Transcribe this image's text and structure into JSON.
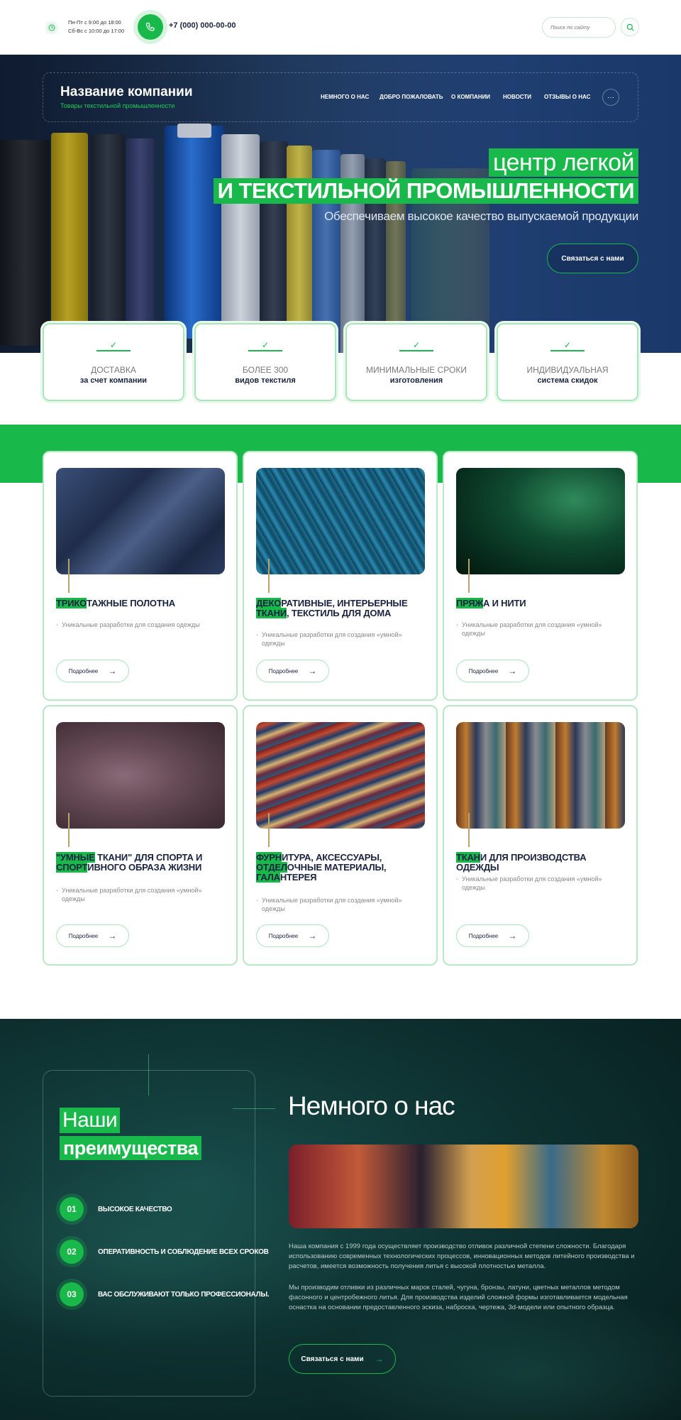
{
  "topbar": {
    "hours_line1": "Пн-Пт с 9:00 до 18:00",
    "hours_line2": "Сб-Вс с 10:00 до 17:00",
    "phone": "+7 (000) 000-00-00",
    "search_placeholder": "Поиск по сайту"
  },
  "header": {
    "company_name": "Название компании",
    "company_sub": "Товары текстильной промышленности",
    "nav": [
      "Немного о нас",
      "Добро пожаловать",
      "О компании",
      "Новости",
      "Отзывы о нас"
    ],
    "more": "···"
  },
  "hero": {
    "title_line1": "центр легкой",
    "title_line2": "И ТЕКСТИЛЬНОЙ ПРОМЫШЛЕННОСТИ",
    "subtitle": "Обеспечиваем высокое качество выпускаемой продукции",
    "cta": "Связаться с нами"
  },
  "features": [
    {
      "top": "Доставка",
      "bottom": "за счет компании"
    },
    {
      "top": "Более 300",
      "bottom": "видов текстиля"
    },
    {
      "top": "Минимальные сроки",
      "bottom": "изготовления"
    },
    {
      "top": "Индивидуальная",
      "bottom": "система скидок"
    }
  ],
  "products": [
    {
      "title_hl": "Трико",
      "title_rest": "тажные полотна",
      "title_hl2": "",
      "title_rest2": "",
      "desc": "Уникальные разработки для создания одежды",
      "button": "Подробнее"
    },
    {
      "title_hl": "Деко",
      "title_rest": "ративные, интерьерные",
      "title_hl2": "ткани",
      "title_rest2": ", текстиль для дома",
      "desc": "Уникальные разработки для создания «умной» одежды",
      "button": "Подробнее"
    },
    {
      "title_hl": "Пряж",
      "title_rest": "а и нити",
      "title_hl2": "",
      "title_rest2": "",
      "desc": "Уникальные разработки для создания «умной» одежды",
      "button": "Подробнее"
    },
    {
      "title_hl": "\"Умные",
      "title_rest": " ткани\" для спорта и",
      "title_hl2": "спорт",
      "title_rest2": "ивного образа жизни",
      "desc": "Уникальные разработки для создания «умной» одежды",
      "button": "Подробнее"
    },
    {
      "title_hl": "Фурн",
      "title_rest": "итура, аксессуары,",
      "title_hl2": "отдел",
      "title_rest2": "очные материалы,",
      "title_hl3": "гала",
      "title_rest3": "нтерея",
      "desc": "Уникальные разработки для создания «умной» одежды",
      "button": "Подробнее"
    },
    {
      "title_hl": "Ткан",
      "title_rest": "и для производства одежды",
      "title_hl2": "",
      "title_rest2": "",
      "desc": "Уникальные разработки для создания «умной» одежды",
      "button": "Подробнее"
    }
  ],
  "advantages": {
    "title1": "Наши",
    "title2": "преимущества",
    "items": [
      {
        "num": "01",
        "label": "Высокое качество"
      },
      {
        "num": "02",
        "label": "Оперативность и соблюдение всех сроков"
      },
      {
        "num": "03",
        "label": "Вас обслуживают только профессионалы."
      }
    ]
  },
  "about": {
    "title": "Немного о нас",
    "p1": "Наша компания с 1999 года осуществляет производство отливок различной степени сложности. Благодаря использованию современных технологических процессов, инновационных методов литейного производства и расчетов, имеется возможность получения литья с высокой плотностью металла.",
    "p2": "Мы производим отливки из различных марок сталей, чугуна, бронзы, латуни, цветных металлов методом фасонного и центробежного литья. Для производства изделий сложной формы изготавливается модельная оснастка на основании предоставленного эскиза, наброска, чертежа, 3d-модели или опытного образца.",
    "cta": "Связаться с нами"
  },
  "colors": {
    "accent": "#19b84a",
    "dark": "#1a2340",
    "teal": "#0f3534"
  }
}
